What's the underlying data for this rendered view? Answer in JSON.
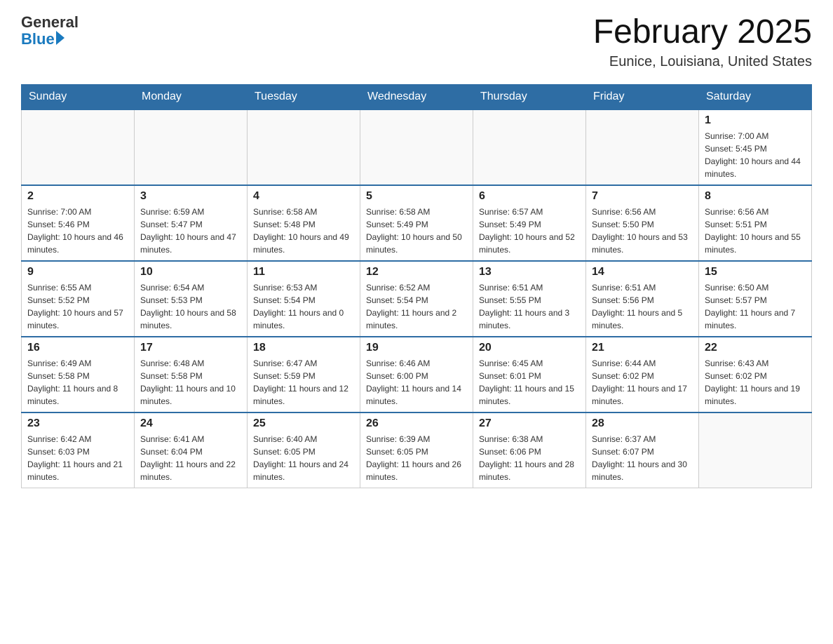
{
  "header": {
    "logo_general": "General",
    "logo_blue": "Blue",
    "title": "February 2025",
    "subtitle": "Eunice, Louisiana, United States"
  },
  "days_of_week": [
    "Sunday",
    "Monday",
    "Tuesday",
    "Wednesday",
    "Thursday",
    "Friday",
    "Saturday"
  ],
  "weeks": [
    [
      {
        "day": "",
        "info": ""
      },
      {
        "day": "",
        "info": ""
      },
      {
        "day": "",
        "info": ""
      },
      {
        "day": "",
        "info": ""
      },
      {
        "day": "",
        "info": ""
      },
      {
        "day": "",
        "info": ""
      },
      {
        "day": "1",
        "info": "Sunrise: 7:00 AM\nSunset: 5:45 PM\nDaylight: 10 hours and 44 minutes."
      }
    ],
    [
      {
        "day": "2",
        "info": "Sunrise: 7:00 AM\nSunset: 5:46 PM\nDaylight: 10 hours and 46 minutes."
      },
      {
        "day": "3",
        "info": "Sunrise: 6:59 AM\nSunset: 5:47 PM\nDaylight: 10 hours and 47 minutes."
      },
      {
        "day": "4",
        "info": "Sunrise: 6:58 AM\nSunset: 5:48 PM\nDaylight: 10 hours and 49 minutes."
      },
      {
        "day": "5",
        "info": "Sunrise: 6:58 AM\nSunset: 5:49 PM\nDaylight: 10 hours and 50 minutes."
      },
      {
        "day": "6",
        "info": "Sunrise: 6:57 AM\nSunset: 5:49 PM\nDaylight: 10 hours and 52 minutes."
      },
      {
        "day": "7",
        "info": "Sunrise: 6:56 AM\nSunset: 5:50 PM\nDaylight: 10 hours and 53 minutes."
      },
      {
        "day": "8",
        "info": "Sunrise: 6:56 AM\nSunset: 5:51 PM\nDaylight: 10 hours and 55 minutes."
      }
    ],
    [
      {
        "day": "9",
        "info": "Sunrise: 6:55 AM\nSunset: 5:52 PM\nDaylight: 10 hours and 57 minutes."
      },
      {
        "day": "10",
        "info": "Sunrise: 6:54 AM\nSunset: 5:53 PM\nDaylight: 10 hours and 58 minutes."
      },
      {
        "day": "11",
        "info": "Sunrise: 6:53 AM\nSunset: 5:54 PM\nDaylight: 11 hours and 0 minutes."
      },
      {
        "day": "12",
        "info": "Sunrise: 6:52 AM\nSunset: 5:54 PM\nDaylight: 11 hours and 2 minutes."
      },
      {
        "day": "13",
        "info": "Sunrise: 6:51 AM\nSunset: 5:55 PM\nDaylight: 11 hours and 3 minutes."
      },
      {
        "day": "14",
        "info": "Sunrise: 6:51 AM\nSunset: 5:56 PM\nDaylight: 11 hours and 5 minutes."
      },
      {
        "day": "15",
        "info": "Sunrise: 6:50 AM\nSunset: 5:57 PM\nDaylight: 11 hours and 7 minutes."
      }
    ],
    [
      {
        "day": "16",
        "info": "Sunrise: 6:49 AM\nSunset: 5:58 PM\nDaylight: 11 hours and 8 minutes."
      },
      {
        "day": "17",
        "info": "Sunrise: 6:48 AM\nSunset: 5:58 PM\nDaylight: 11 hours and 10 minutes."
      },
      {
        "day": "18",
        "info": "Sunrise: 6:47 AM\nSunset: 5:59 PM\nDaylight: 11 hours and 12 minutes."
      },
      {
        "day": "19",
        "info": "Sunrise: 6:46 AM\nSunset: 6:00 PM\nDaylight: 11 hours and 14 minutes."
      },
      {
        "day": "20",
        "info": "Sunrise: 6:45 AM\nSunset: 6:01 PM\nDaylight: 11 hours and 15 minutes."
      },
      {
        "day": "21",
        "info": "Sunrise: 6:44 AM\nSunset: 6:02 PM\nDaylight: 11 hours and 17 minutes."
      },
      {
        "day": "22",
        "info": "Sunrise: 6:43 AM\nSunset: 6:02 PM\nDaylight: 11 hours and 19 minutes."
      }
    ],
    [
      {
        "day": "23",
        "info": "Sunrise: 6:42 AM\nSunset: 6:03 PM\nDaylight: 11 hours and 21 minutes."
      },
      {
        "day": "24",
        "info": "Sunrise: 6:41 AM\nSunset: 6:04 PM\nDaylight: 11 hours and 22 minutes."
      },
      {
        "day": "25",
        "info": "Sunrise: 6:40 AM\nSunset: 6:05 PM\nDaylight: 11 hours and 24 minutes."
      },
      {
        "day": "26",
        "info": "Sunrise: 6:39 AM\nSunset: 6:05 PM\nDaylight: 11 hours and 26 minutes."
      },
      {
        "day": "27",
        "info": "Sunrise: 6:38 AM\nSunset: 6:06 PM\nDaylight: 11 hours and 28 minutes."
      },
      {
        "day": "28",
        "info": "Sunrise: 6:37 AM\nSunset: 6:07 PM\nDaylight: 11 hours and 30 minutes."
      },
      {
        "day": "",
        "info": ""
      }
    ]
  ]
}
